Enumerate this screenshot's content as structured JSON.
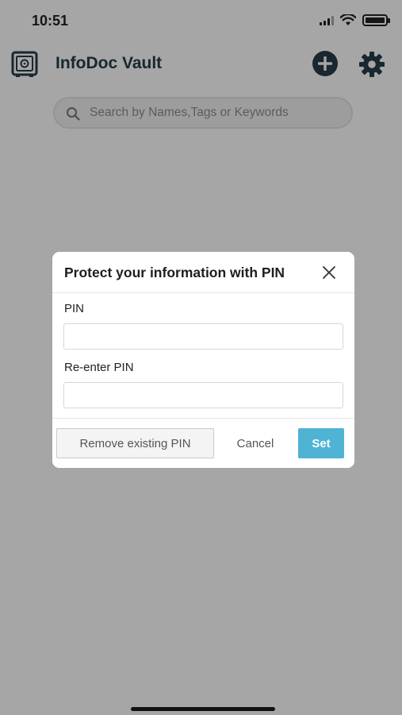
{
  "status_bar": {
    "time": "10:51"
  },
  "header": {
    "title": "InfoDoc Vault",
    "icons": [
      "vault-icon",
      "add-icon",
      "gear-icon"
    ]
  },
  "search": {
    "placeholder": "Search by Names,Tags or Keywords"
  },
  "modal": {
    "title": "Protect your information with PIN",
    "pin_label": "PIN",
    "pin_value": "",
    "reenter_label": "Re-enter PIN",
    "reenter_value": "",
    "remove_button": "Remove existing PIN",
    "cancel_button": "Cancel",
    "set_button": "Set"
  },
  "colors": {
    "brand": "#263c4a",
    "primary_button": "#4fb3d4",
    "overlay": "rgba(0,0,0,0.35)"
  }
}
